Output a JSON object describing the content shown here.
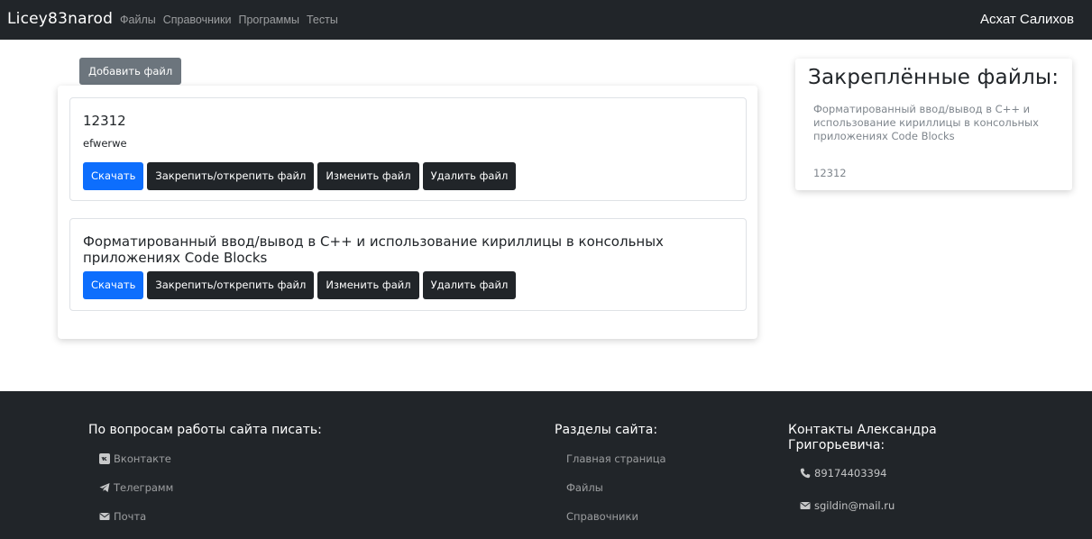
{
  "navbar": {
    "brand": "Licey83narod",
    "links": [
      "Файлы",
      "Справочники",
      "Программы",
      "Тесты"
    ],
    "user": "Асхат Салихов"
  },
  "toolbar": {
    "add_file_label": "Добавить файл"
  },
  "files": [
    {
      "title": "12312",
      "description": "efwerwe",
      "buttons": {
        "download": "Скачать",
        "pin": "Закрепить/открепить файл",
        "edit": "Изменить файл",
        "delete": "Удалить файл"
      }
    },
    {
      "title": "Форматированный ввод/вывод в С++ и использование кириллицы в консольных приложениях Code Blocks",
      "description": "",
      "buttons": {
        "download": "Скачать",
        "pin": "Закрепить/открепить файл",
        "edit": "Изменить файл",
        "delete": "Удалить файл"
      }
    }
  ],
  "pinned": {
    "title": "Закреплённые файлы:",
    "items": [
      "Форматированный ввод/вывод в С++ и использование кириллицы в консольных приложениях Code Blocks",
      "12312"
    ]
  },
  "footer": {
    "support_heading": "По вопросам работы сайта писать:",
    "support_links": [
      "Вконтакте",
      "Телеграмм",
      "Почта"
    ],
    "sections_heading": "Разделы сайта:",
    "sections_links": [
      "Главная страница",
      "Файлы",
      "Справочники"
    ],
    "contacts_heading": "Контакты Александра Григорьевича:",
    "phone": "89174403394",
    "email": "sgildin@mail.ru"
  },
  "icons": {
    "vk": "vk-icon",
    "telegram": "telegram-icon",
    "mail": "mail-icon",
    "phone": "phone-icon"
  },
  "colors": {
    "navbar_bg": "#212529",
    "primary": "#0d6efd",
    "secondary": "#6c757d",
    "dark": "#212529"
  }
}
